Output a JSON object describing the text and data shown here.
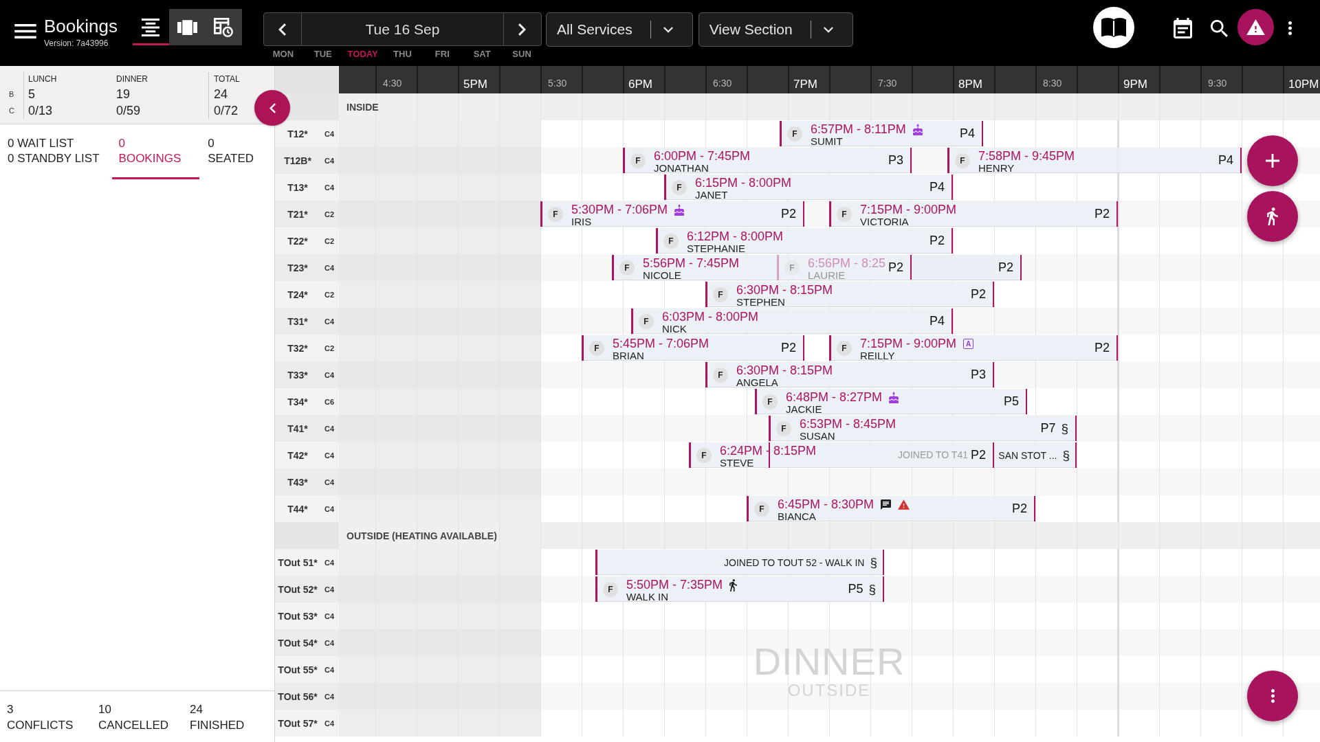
{
  "app_bar": {
    "title": "Bookings",
    "version": "Version: 7a43996",
    "views": [
      {
        "kind": "list",
        "selected": true
      },
      {
        "kind": "panels",
        "selected": false
      },
      {
        "kind": "schedule",
        "selected": false
      }
    ],
    "date": "Tue 16 Sep",
    "days": [
      {
        "label": "MON",
        "selected": false
      },
      {
        "label": "TUE",
        "selected": false
      },
      {
        "label": "TODAY",
        "selected": true
      },
      {
        "label": "THU",
        "selected": false
      },
      {
        "label": "FRI",
        "selected": false
      },
      {
        "label": "SAT",
        "selected": false
      },
      {
        "label": "SUN",
        "selected": false
      }
    ],
    "dropdowns": [
      {
        "label": "All Services"
      },
      {
        "label": "View Section"
      }
    ]
  },
  "summary": {
    "row_labels": [
      "B",
      "C"
    ],
    "columns": [
      {
        "heading": "LUNCH",
        "values": [
          "5",
          "0/13"
        ]
      },
      {
        "heading": "DINNER",
        "values": [
          "19",
          "0/59"
        ]
      },
      {
        "heading": "TOTAL",
        "values": [
          "24",
          "0/72"
        ]
      }
    ]
  },
  "list_tabs": [
    {
      "lines": [
        "0 WAIT LIST",
        "0 STANDBY LIST"
      ],
      "selected": false
    },
    {
      "lines": [
        "0",
        "BOOKINGS"
      ],
      "selected": true
    },
    {
      "lines": [
        "0",
        "SEATED"
      ],
      "selected": false
    }
  ],
  "totals": [
    {
      "count": "3",
      "label": "CONFLICTS"
    },
    {
      "count": "10",
      "label": "CANCELLED"
    },
    {
      "count": "24",
      "label": "FINISHED"
    }
  ],
  "timeline": {
    "times": [
      "4:30",
      "5PM",
      "5:30",
      "6PM",
      "6:30",
      "7PM",
      "7:30",
      "8PM",
      "8:30",
      "9PM",
      "9:30",
      "10PM"
    ],
    "sections": [
      {
        "title": "INSIDE",
        "tables": [
          {
            "name": "T12*",
            "capacity": "C4",
            "bookings": [
              {
                "kind": "booking",
                "badge": "F",
                "time": "6:57PM - 8:11PM",
                "guest": "SUMIT",
                "party": "P4",
                "dimmed": false,
                "icons": [
                  {
                    "kind": "cake"
                  }
                ]
              }
            ]
          },
          {
            "name": "T12B*",
            "capacity": "C4",
            "bookings": [
              {
                "kind": "booking",
                "badge": "F",
                "time": "6:00PM - 7:45PM",
                "guest": "JONATHAN",
                "party": "P3",
                "dimmed": false
              },
              {
                "kind": "booking",
                "badge": "F",
                "time": "7:58PM - 9:45PM",
                "guest": "HENRY",
                "party": "P4",
                "dimmed": false
              }
            ]
          },
          {
            "name": "T13*",
            "capacity": "C4",
            "bookings": [
              {
                "kind": "booking",
                "badge": "F",
                "time": "6:15PM - 8:00PM",
                "guest": "JANET",
                "party": "P4",
                "dimmed": false
              }
            ]
          },
          {
            "name": "T21*",
            "capacity": "C2",
            "bookings": [
              {
                "kind": "booking",
                "badge": "F",
                "time": "5:30PM - 7:06PM",
                "guest": "IRIS",
                "party": "P2",
                "dimmed": false,
                "icons": [
                  {
                    "kind": "cake"
                  }
                ]
              },
              {
                "kind": "booking",
                "badge": "F",
                "time": "7:15PM - 9:00PM",
                "guest": "VICTORIA",
                "party": "P2",
                "dimmed": false
              }
            ]
          },
          {
            "name": "T22*",
            "capacity": "C2",
            "bookings": [
              {
                "kind": "booking",
                "badge": "F",
                "time": "6:12PM - 8:00PM",
                "guest": "STEPHANIE",
                "party": "P2",
                "dimmed": false
              }
            ]
          },
          {
            "name": "T23*",
            "capacity": "C4",
            "bookings": [
              {
                "kind": "booking",
                "badge": "F",
                "time": "5:56PM - 7:45PM",
                "guest": "NICOLE",
                "party": "P2",
                "dimmed": false
              },
              {
                "kind": "booking",
                "badge": "F",
                "time": "6:56PM - 8:25",
                "guest": "LAURIE",
                "party": "P2",
                "dimmed": true
              }
            ]
          },
          {
            "name": "T24*",
            "capacity": "C2",
            "bookings": [
              {
                "kind": "booking",
                "badge": "F",
                "time": "6:30PM - 8:15PM",
                "guest": "STEPHEN",
                "party": "P2",
                "dimmed": false
              }
            ]
          },
          {
            "name": "T31*",
            "capacity": "C4",
            "bookings": [
              {
                "kind": "booking",
                "badge": "F",
                "time": "6:03PM - 8:00PM",
                "guest": "NICK",
                "party": "P4",
                "dimmed": false
              }
            ]
          },
          {
            "name": "T32*",
            "capacity": "C2",
            "bookings": [
              {
                "kind": "booking",
                "badge": "F",
                "time": "5:45PM - 7:06PM",
                "guest": "BRIAN",
                "party": "P2",
                "dimmed": false
              },
              {
                "kind": "booking",
                "badge": "F",
                "time": "7:15PM - 9:00PM",
                "guest": "REILLY",
                "party": "P2",
                "dimmed": false,
                "icons": [
                  {
                    "kind": "tag",
                    "text": "A"
                  }
                ]
              }
            ]
          },
          {
            "name": "T33*",
            "capacity": "C4",
            "bookings": [
              {
                "kind": "booking",
                "badge": "F",
                "time": "6:30PM - 8:15PM",
                "guest": "ANGELA",
                "party": "P3",
                "dimmed": false
              }
            ]
          },
          {
            "name": "T34*",
            "capacity": "C6",
            "bookings": [
              {
                "kind": "booking",
                "badge": "F",
                "time": "6:48PM - 8:27PM",
                "guest": "JACKIE",
                "party": "P5",
                "dimmed": false,
                "icons": [
                  {
                    "kind": "cake"
                  }
                ]
              }
            ]
          },
          {
            "name": "T41*",
            "capacity": "C4",
            "bookings": [
              {
                "kind": "booking",
                "badge": "F",
                "time": "6:53PM - 8:45PM",
                "guest": "SUSAN",
                "party": "P7",
                "dimmed": false,
                "link_mark": "§"
              }
            ]
          },
          {
            "name": "T42*",
            "capacity": "C4",
            "bookings": [
              {
                "kind": "booking",
                "badge": "F",
                "time": "6:24PM - 8:15PM",
                "guest": "STEVE",
                "party": "P2",
                "dimmed": false
              },
              {
                "kind": "joined",
                "links_row_above": true,
                "labels": [
                  "JOINED TO T41",
                  "SAN STOT ..."
                ],
                "link_mark": "§"
              }
            ]
          },
          {
            "name": "T43*",
            "capacity": "C4"
          },
          {
            "name": "T44*",
            "capacity": "C4",
            "bookings": [
              {
                "kind": "booking",
                "badge": "F",
                "time": "6:45PM - 8:30PM",
                "guest": "BIANCA",
                "party": "P2",
                "dimmed": false,
                "icons": [
                  {
                    "kind": "note"
                  },
                  {
                    "kind": "alert"
                  }
                ]
              }
            ]
          }
        ]
      },
      {
        "title": "OUTSIDE (HEATING AVAILABLE)",
        "watermark": {
          "service": "DINNER",
          "area": "OUTSIDE"
        },
        "tables": [
          {
            "name": "TOut 51*",
            "capacity": "C4",
            "bookings": [
              {
                "kind": "joined",
                "links_row_above": false,
                "labels": [
                  "JOINED TO TOUT 52 - WALK IN"
                ],
                "link_mark": "§"
              }
            ]
          },
          {
            "name": "TOut 52*",
            "capacity": "C4",
            "bookings": [
              {
                "kind": "booking",
                "badge": "F",
                "time": "5:50PM - 7:35PM",
                "guest": "WALK IN",
                "party": "P5",
                "dimmed": false,
                "icons": [
                  {
                    "kind": "walk"
                  }
                ],
                "link_mark": "§"
              }
            ]
          },
          {
            "name": "TOut 53*",
            "capacity": "C4"
          },
          {
            "name": "TOut 54*",
            "capacity": "C4"
          },
          {
            "name": "TOut 55*",
            "capacity": "C4"
          },
          {
            "name": "TOut 56*",
            "capacity": "C4"
          },
          {
            "name": "TOut 57*",
            "capacity": "C4"
          }
        ]
      }
    ]
  }
}
